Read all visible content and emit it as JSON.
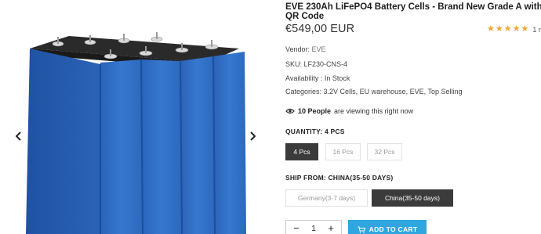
{
  "product": {
    "title": "EVE 230Ah LiFePO4 Battery Cells - Brand New Grade A with QR Code",
    "price": "€549,00 EUR",
    "rating_stars": 5,
    "review_count": "1 re",
    "vendor_label": "Vendor:",
    "vendor_value": "EVE",
    "sku_label": "SKU:",
    "sku_value": "LF230-CNS-4",
    "availability_label": "Availability :",
    "availability_value": "In Stock",
    "categories_label": "Categories:",
    "categories_value": "3.2V Cells, EU warehouse, EVE, Top Selling",
    "viewers_count": "10 People",
    "viewers_text": "are viewing this right now"
  },
  "options": {
    "quantity_label": "QUANTITY: 4 PCS",
    "quantity_choices": [
      "4 Pcs",
      "16 Pcs",
      "32 Pcs"
    ],
    "ship_label": "SHIP FROM: CHINA(35-50 DAYS)",
    "ship_choices": [
      "Germany(3-7 days)",
      "China(35-50 days)"
    ]
  },
  "cart": {
    "qty_value": "1",
    "minus": "−",
    "plus": "+",
    "add_to_cart": "ADD TO CART"
  },
  "colors": {
    "cell_blue": "#2f6fc4",
    "accent": "#2fa6e0",
    "star": "#f2a630",
    "selected_chip": "#3b3b3b"
  },
  "icons": {
    "prev": "chevron-left-icon",
    "next": "chevron-right-icon",
    "viewers": "eye-icon",
    "cart": "cart-icon",
    "star": "star-icon"
  }
}
